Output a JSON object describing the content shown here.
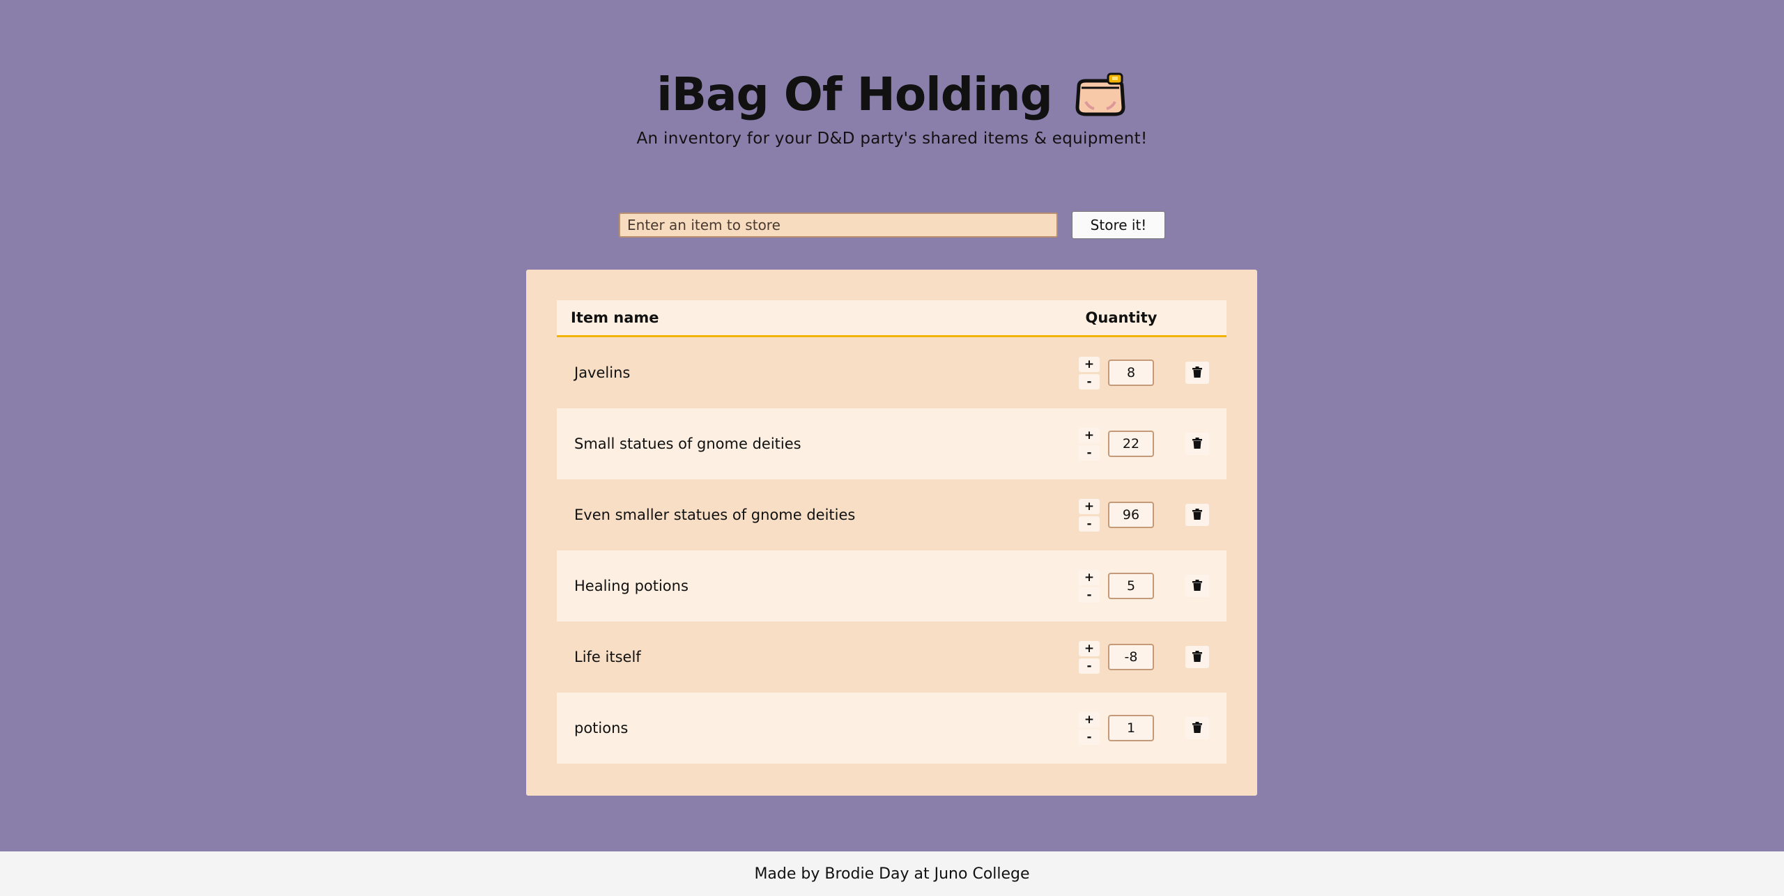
{
  "header": {
    "title": "iBag Of Holding",
    "subtitle": "An inventory for your D&D party's shared items & equipment!",
    "icon": "bag-icon"
  },
  "form": {
    "placeholder": "Enter an item to store",
    "value": "",
    "button_label": "Store it!"
  },
  "table": {
    "col_name": "Item name",
    "col_quantity": "Quantity",
    "plus_label": "+",
    "minus_label": "-",
    "rows": [
      {
        "name": "Javelins",
        "quantity": "8"
      },
      {
        "name": "Small statues of gnome deities",
        "quantity": "22"
      },
      {
        "name": "Even smaller statues of gnome deities",
        "quantity": "96"
      },
      {
        "name": "Healing potions",
        "quantity": "5"
      },
      {
        "name": "Life itself",
        "quantity": "-8"
      },
      {
        "name": "potions",
        "quantity": "1"
      }
    ]
  },
  "footer": {
    "credit": "Made by Brodie Day at Juno College"
  },
  "colors": {
    "background": "#8a7fab",
    "panel": "#f7dec5",
    "row_alt": "#fdf0e2",
    "accent": "#f2b400",
    "footer": "#f4f4f4"
  }
}
